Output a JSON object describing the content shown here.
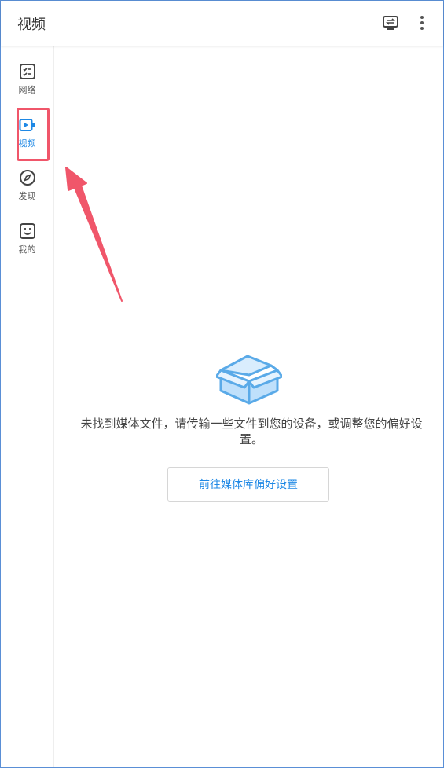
{
  "header": {
    "title": "视频",
    "cast_icon": "cast-screen-icon",
    "more_icon": "more-vertical-icon"
  },
  "sidebar": {
    "items": [
      {
        "label": "网络",
        "icon": "network-list-icon",
        "active": false
      },
      {
        "label": "视频",
        "icon": "video-camera-icon",
        "active": true
      },
      {
        "label": "发现",
        "icon": "compass-icon",
        "active": false
      },
      {
        "label": "我的",
        "icon": "smiley-face-icon",
        "active": false
      }
    ]
  },
  "main": {
    "empty_icon": "open-box-icon",
    "message": "未找到媒体文件，请传输一些文件到您的设备，或调整您的偏好设置。",
    "button_label": "前往媒体库偏好设置"
  },
  "annotation": {
    "highlight_color": "#f0566a"
  },
  "colors": {
    "accent": "#1e88e5",
    "box_fill": "#bfe0fb",
    "box_stroke": "#5aaae8"
  }
}
